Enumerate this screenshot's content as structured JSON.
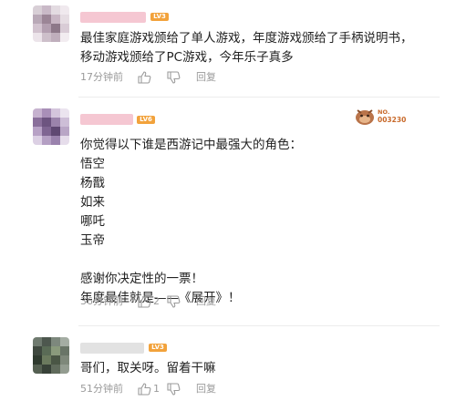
{
  "comments": [
    {
      "username": "",
      "level": "LV3",
      "text": "最佳家庭游戏颁给了单人游戏，年度游戏颁给了手柄说明书，\n移动游戏颁给了PC游戏，今年乐子真多",
      "time": "17分钟前",
      "likes": "",
      "reply_label": "回复"
    },
    {
      "username": "",
      "level": "LV6",
      "badge_no": "NO.",
      "badge_num": "003230",
      "text": "你觉得以下谁是西游记中最强大的角色：\n悟空\n杨戬\n如来\n哪吒\n玉帝\n\n感谢你决定性的一票！\n年度最佳就是——《展开》！",
      "time": "36分钟前",
      "likes": "2",
      "reply_label": "回复"
    },
    {
      "username": "",
      "level": "LV3",
      "text": "哥们，取关呀。留着干嘛",
      "time": "51分钟前",
      "likes": "1",
      "reply_label": "回复"
    }
  ],
  "colors": {
    "level_badge": "#f2a23b",
    "username_blur": "#f5c7d2",
    "meta_text": "#9a9a9a"
  },
  "icons": [
    "thumbs-up-icon",
    "thumbs-down-icon"
  ]
}
